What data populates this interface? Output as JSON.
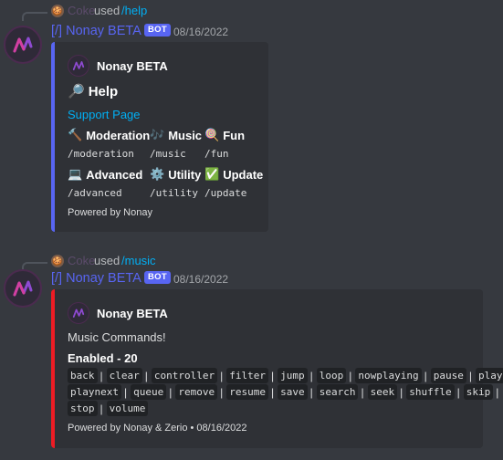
{
  "messages": [
    {
      "reply": {
        "user": "Coke",
        "used": "used",
        "command": "/help"
      },
      "author": "[/] Nonay BETA",
      "bot_tag": "BOT",
      "timestamp": "08/16/2022",
      "embed": {
        "color": "#5865f2",
        "author_name": "Nonay BETA",
        "title": "Help",
        "link": "Support Page",
        "fields": [
          {
            "name": "Moderation",
            "value": "/moderation",
            "icon": "hammer-icon"
          },
          {
            "name": "Music",
            "value": "/music",
            "icon": "music-notes-icon"
          },
          {
            "name": "Fun",
            "value": "/fun",
            "icon": "lollipop-icon"
          },
          {
            "name": "Advanced",
            "value": "/advanced",
            "icon": "laptop-icon"
          },
          {
            "name": "Utility",
            "value": "/utility",
            "icon": "gear-icon"
          },
          {
            "name": "Update",
            "value": "/update",
            "icon": "check-mark-icon"
          }
        ],
        "footer": "Powered by Nonay"
      }
    },
    {
      "reply": {
        "user": "Coke",
        "used": "used",
        "command": "/music"
      },
      "author": "[/] Nonay BETA",
      "bot_tag": "BOT",
      "timestamp": "08/16/2022",
      "embed": {
        "color": "#ed1c24",
        "author_name": "Nonay BETA",
        "description": "Music Commands!",
        "enabled_label": "Enabled - 20",
        "commands": [
          "back",
          "clear",
          "controller",
          "filter",
          "jump",
          "loop",
          "nowplaying",
          "pause",
          "play",
          "playnext",
          "queue",
          "remove",
          "resume",
          "save",
          "search",
          "seek",
          "shuffle",
          "skip",
          "stop",
          "volume"
        ],
        "footer": "Powered by Nonay & Zerio • 08/16/2022"
      }
    }
  ]
}
